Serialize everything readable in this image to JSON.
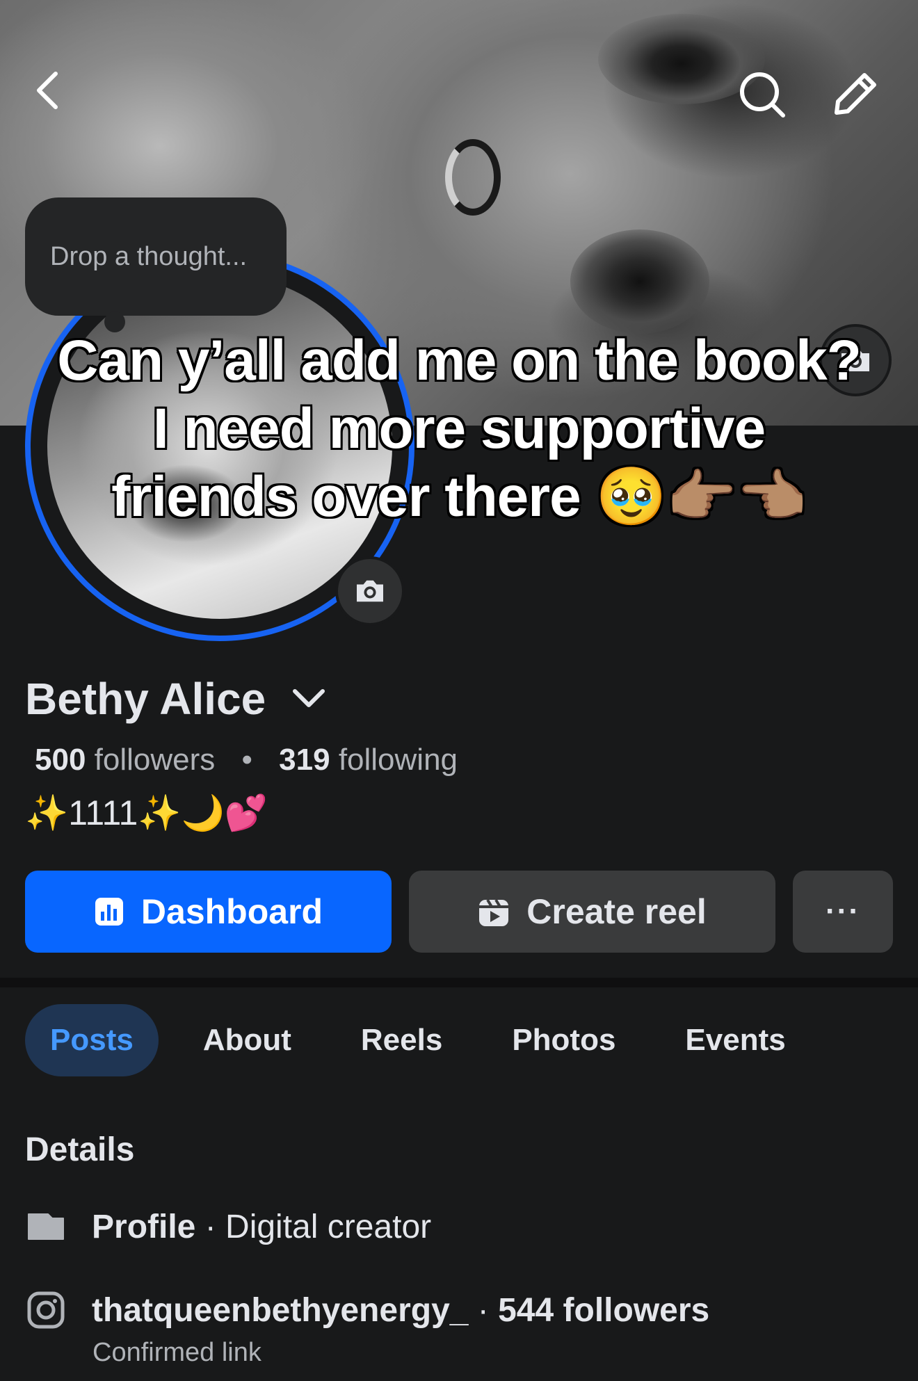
{
  "cover": {
    "thought_placeholder": "Drop a thought..."
  },
  "caption": {
    "line1": "Can y’all add me on the book?",
    "line2": "I need more supportive",
    "line3": "friends over there 🥹👉🏽👈🏽"
  },
  "profile": {
    "name": "Bethy Alice",
    "followers_count": "500",
    "followers_label": "followers",
    "following_count": "319",
    "following_label": "following",
    "separator": "•",
    "bio": "✨1111✨🌙💕"
  },
  "actions": {
    "dashboard_label": "Dashboard",
    "create_reel_label": "Create reel",
    "more_label": "···"
  },
  "tabs": [
    {
      "label": "Posts",
      "active": true
    },
    {
      "label": "About"
    },
    {
      "label": "Reels"
    },
    {
      "label": "Photos"
    },
    {
      "label": "Events"
    }
  ],
  "details": {
    "title": "Details",
    "profile_label": "Profile",
    "profile_sep": " · ",
    "profile_value": "Digital creator",
    "ig_handle": "thatqueenbethyenergy_",
    "ig_sep": " · ",
    "ig_followers": "544 followers",
    "ig_sub": "Confirmed link"
  },
  "colors": {
    "accent": "#0866ff",
    "ring": "#1763f2",
    "background": "#18191a"
  },
  "icons": [
    "back-icon",
    "search-icon",
    "edit-icon",
    "camera-icon",
    "dashboard-icon",
    "reel-icon",
    "profile-card-icon",
    "instagram-icon",
    "chevron-down-icon"
  ]
}
